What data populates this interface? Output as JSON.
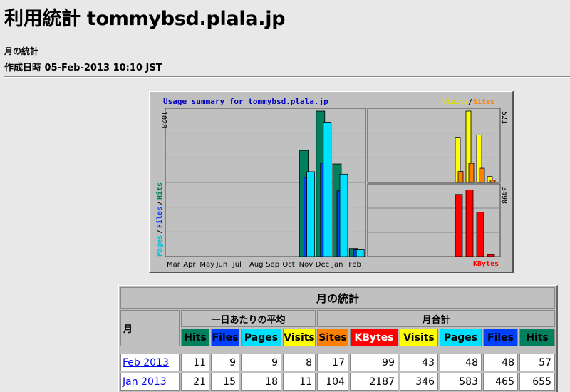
{
  "page": {
    "title": "利用統計 tommybsd.plala.jp",
    "subtitle": "月の統計",
    "created": "作成日時 05-Feb-2013 10:10 JST"
  },
  "colors": {
    "hits": "#00805c",
    "files": "#0040ff",
    "pages": "#00e0ff",
    "visits": "#ffff00",
    "sites": "#ff8000",
    "kbytes": "#ff0000"
  },
  "chart_data": {
    "type": "bar",
    "title": "Usage summary for tommybsd.plala.jp",
    "categories": [
      "Mar",
      "Apr",
      "May",
      "Jun",
      "Jul",
      "Aug",
      "Sep",
      "Oct",
      "Nov",
      "Dec",
      "Jan",
      "Feb"
    ],
    "left_axis": {
      "max_label": "1028",
      "label_pages": "Pages",
      "label_files": "Files",
      "label_hits": "Hits",
      "sep": "/"
    },
    "right_top_axis": {
      "max_label": "521",
      "label_visits": "Visits",
      "label_sites": "Sites",
      "sep": "/"
    },
    "right_bottom_axis": {
      "max_label": "3498",
      "label_kbytes": "KBytes"
    },
    "series_left": [
      {
        "name": "Hits",
        "values": [
          0,
          0,
          0,
          0,
          0,
          0,
          0,
          0,
          750,
          1028,
          655,
          57
        ]
      },
      {
        "name": "Files",
        "values": [
          0,
          0,
          0,
          0,
          0,
          0,
          0,
          0,
          560,
          660,
          465,
          48
        ]
      },
      {
        "name": "Pages",
        "values": [
          0,
          0,
          0,
          0,
          0,
          0,
          0,
          0,
          600,
          950,
          583,
          48
        ]
      }
    ],
    "visits_sites_categories": [
      "Nov",
      "Dec",
      "Jan",
      "Feb"
    ],
    "series_visits": [
      {
        "name": "Visits",
        "values": [
          330,
          521,
          346,
          43
        ]
      }
    ],
    "series_sites": [
      {
        "name": "Sites",
        "values": [
          80,
          140,
          104,
          17
        ]
      }
    ],
    "series_kbytes": [
      {
        "name": "KBytes",
        "values": [
          3050,
          3270,
          2187,
          99
        ]
      }
    ]
  },
  "table": {
    "caption": "月の統計",
    "month_header": "月",
    "daily_avg_header": "一日あたりの平均",
    "monthly_total_header": "月合計",
    "columns": [
      "Hits",
      "Files",
      "Pages",
      "Visits",
      "Sites",
      "KBytes",
      "Visits",
      "Pages",
      "Files",
      "Hits"
    ],
    "rows": [
      {
        "month": "Feb 2013",
        "values": [
          "11",
          "9",
          "9",
          "8",
          "17",
          "99",
          "43",
          "48",
          "48",
          "57"
        ]
      },
      {
        "month": "Jan 2013",
        "values": [
          "21",
          "15",
          "18",
          "11",
          "104",
          "2187",
          "346",
          "583",
          "465",
          "655"
        ]
      }
    ]
  }
}
